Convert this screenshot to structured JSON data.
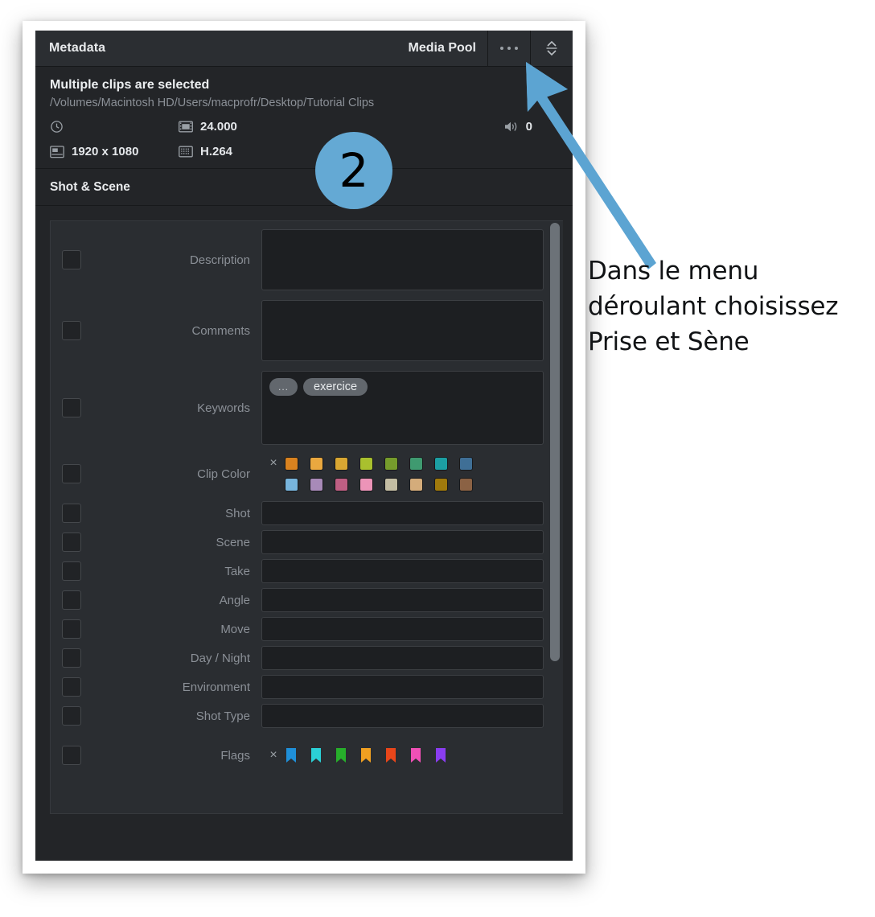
{
  "panel": {
    "header": {
      "title": "Metadata",
      "media_pool_label": "Media Pool",
      "options_icon": "more-options-icon",
      "expand_icon": "expand-collapse-chevrons-icon"
    },
    "clip_summary": {
      "title": "Multiple clips are selected",
      "path": "/Volumes/Macintosh HD/Users/macprofr/Desktop/Tutorial Clips",
      "info": [
        {
          "icon": "clock-icon",
          "value": ""
        },
        {
          "icon": "film-frame-rate-icon",
          "value": "24.000"
        },
        {
          "icon": "speaker-audio-icon",
          "value": "0"
        },
        {
          "icon": "resolution-layers-icon",
          "value": "1920 x 1080"
        },
        {
          "icon": "codec-grid-icon",
          "value": "H.264"
        }
      ]
    },
    "section_title": "Shot & Scene",
    "fields": [
      {
        "label": "Description",
        "type": "textarea",
        "value": ""
      },
      {
        "label": "Comments",
        "type": "textarea",
        "value": ""
      },
      {
        "label": "Keywords",
        "type": "keywords",
        "tags": [
          "...",
          "exercice"
        ]
      },
      {
        "label": "Clip Color",
        "type": "colors"
      },
      {
        "label": "Shot",
        "type": "text",
        "value": ""
      },
      {
        "label": "Scene",
        "type": "text",
        "value": ""
      },
      {
        "label": "Take",
        "type": "text",
        "value": ""
      },
      {
        "label": "Angle",
        "type": "text",
        "value": ""
      },
      {
        "label": "Move",
        "type": "text",
        "value": ""
      },
      {
        "label": "Day / Night",
        "type": "text",
        "value": ""
      },
      {
        "label": "Environment",
        "type": "text",
        "value": ""
      },
      {
        "label": "Shot Type",
        "type": "text",
        "value": ""
      },
      {
        "label": "Flags",
        "type": "flags"
      }
    ],
    "clip_colors": {
      "clear_label": "×",
      "row1": [
        "#d9821f",
        "#eaa83f",
        "#d9a732",
        "#a9c02e",
        "#769c2c",
        "#3f9a70",
        "#1c9fa3",
        "#3f6f96"
      ],
      "row2": [
        "#78b5dd",
        "#a88ab8",
        "#bf5f83",
        "#ec94b8",
        "#c3bda3",
        "#d4ac7b",
        "#a07a0c",
        "#8b6244"
      ]
    },
    "flags": {
      "clear_label": "×",
      "colors": [
        "#1f8fd8",
        "#2bd0d6",
        "#27ae2b",
        "#f0a021",
        "#e8461a",
        "#f050b6",
        "#8a3df0"
      ]
    }
  },
  "annotation": {
    "badge_number": "2",
    "text": "Dans le menu déroulant choisissez Prise et Sène",
    "accent_color": "#64a9d4"
  }
}
